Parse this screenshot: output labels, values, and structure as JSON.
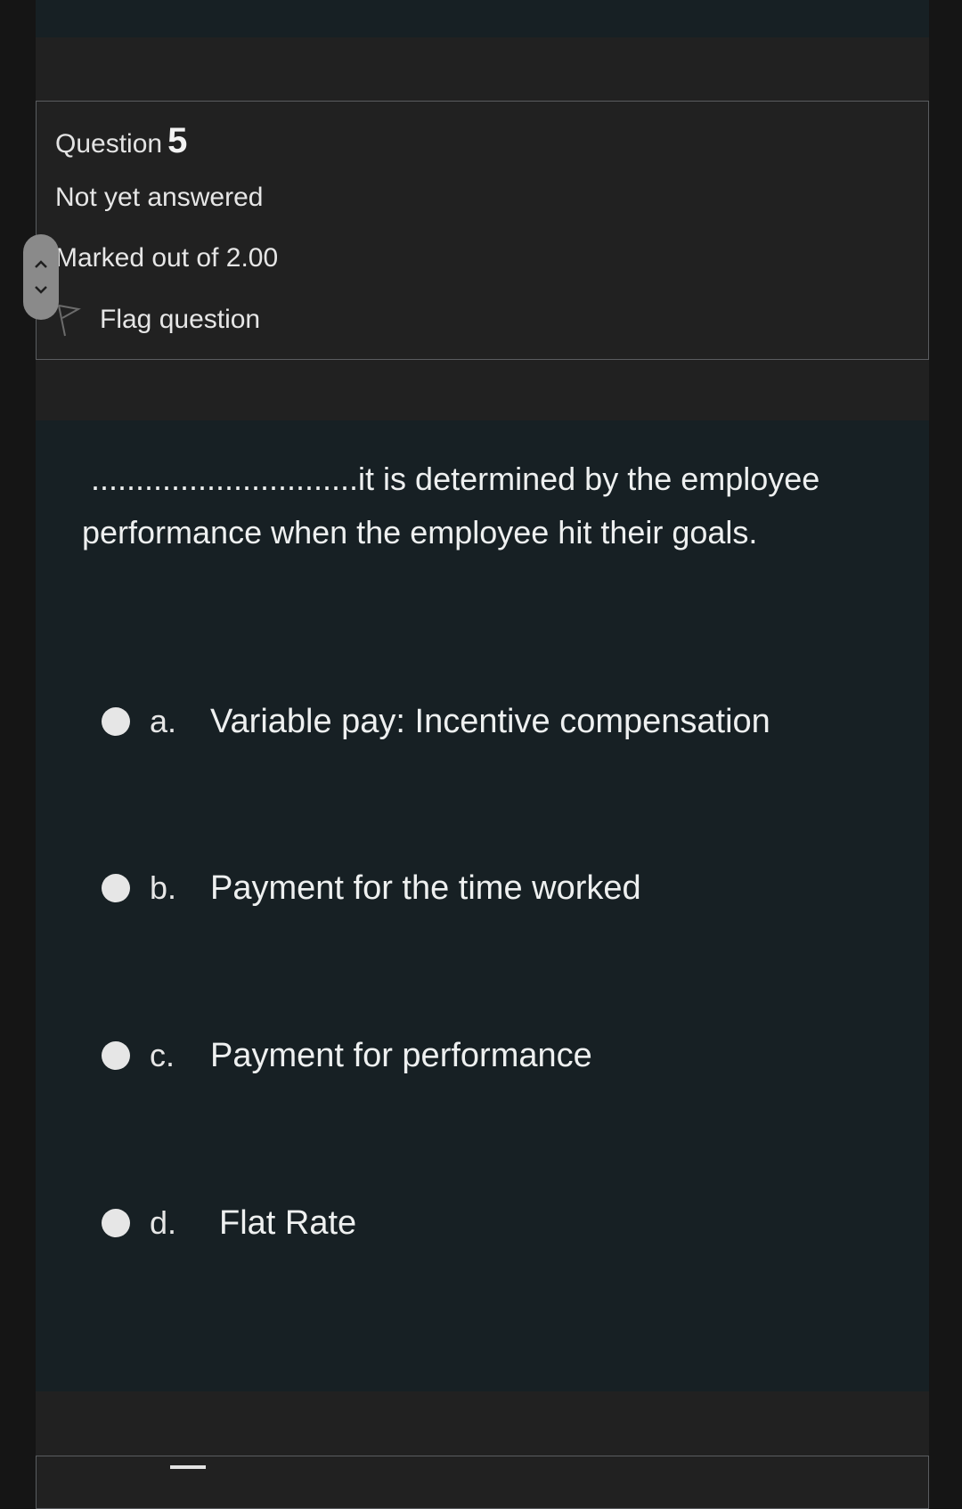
{
  "question": {
    "label": "Question",
    "number": "5",
    "status": "Not yet answered",
    "marked_out_of": "Marked out of 2.00",
    "flag_label": "Flag question",
    "text_line1": "..............................it is determined by the employee",
    "text_line2": "performance when the employee hit their goals."
  },
  "answers": [
    {
      "letter": "a.",
      "text": "Variable pay: Incentive compensation",
      "selected": false
    },
    {
      "letter": "b.",
      "text": "Payment for the time worked",
      "selected": false
    },
    {
      "letter": "c.",
      "text": "Payment for performance",
      "selected": false
    },
    {
      "letter": "d.",
      "text": "Flat Rate",
      "selected": false
    }
  ],
  "icons": {
    "flag": "flag-outline-icon",
    "scroll_up": "chevron-up-icon",
    "scroll_down": "chevron-down-icon"
  },
  "colors": {
    "page_bg": "#212121",
    "content_bg": "#172024",
    "text": "#e6e6e6",
    "radio": "#e6e6e6"
  }
}
